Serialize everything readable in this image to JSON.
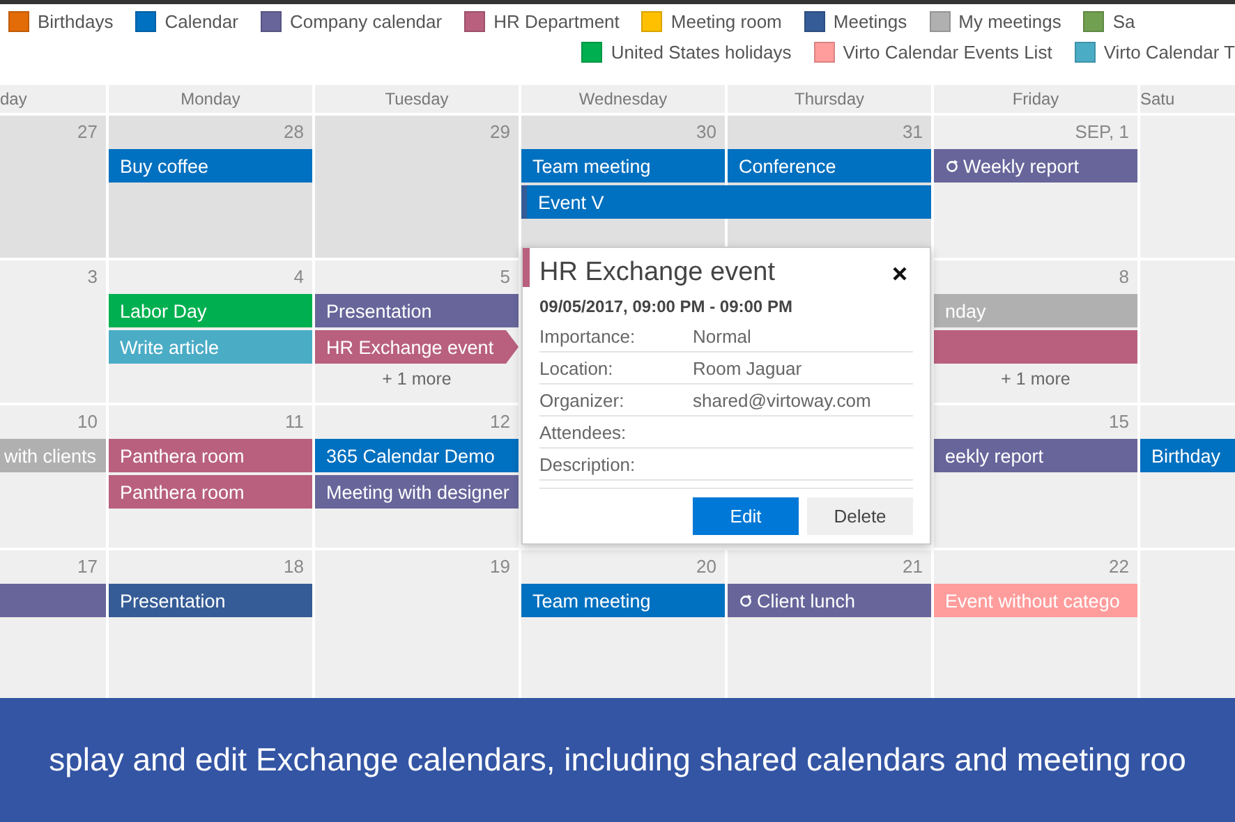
{
  "legend": [
    [
      {
        "label": "Birthdays",
        "color": "#e36c09"
      },
      {
        "label": "Calendar",
        "color": "#0070c0"
      },
      {
        "label": "Company calendar",
        "color": "#67659a"
      },
      {
        "label": "HR Department",
        "color": "#b9607e"
      },
      {
        "label": "Meeting room",
        "color": "#ffc000"
      },
      {
        "label": "Meetings",
        "color": "#355c96"
      },
      {
        "label": "My meetings",
        "color": "#b0b0b0"
      },
      {
        "label": "Sa",
        "color": "#70a050"
      }
    ],
    [
      {
        "label": "United States holidays",
        "color": "#00b050"
      },
      {
        "label": "Virto Calendar Events List",
        "color": "#ff9c9c"
      },
      {
        "label": "Virto Calendar T",
        "color": "#4bacc6"
      }
    ]
  ],
  "weekdays": [
    "day",
    "Monday",
    "Tuesday",
    "Wednesday",
    "Thursday",
    "Friday",
    "Satu"
  ],
  "weeks": [
    {
      "days": [
        {
          "past": true,
          "date": "27"
        },
        {
          "past": true,
          "date": "28",
          "events": [
            {
              "title": "Buy coffee",
              "color": "#0070c0",
              "recurring": false,
              "continues": false,
              "selected": false
            }
          ]
        },
        {
          "past": true,
          "date": "29"
        },
        {
          "past": true,
          "date": "30",
          "events": [
            {
              "title": "Team meeting",
              "color": "#0070c0",
              "recurring": false,
              "continues": false,
              "selected": false
            },
            {
              "title": "Event V",
              "color": "#0070c0",
              "recurring": false,
              "continues": true,
              "selected": false
            }
          ]
        },
        {
          "past": true,
          "date": "31",
          "events": [
            {
              "title": "Conference",
              "color": "#0070c0",
              "recurring": false,
              "continues": false,
              "selected": false
            }
          ]
        },
        {
          "past": false,
          "date": "SEP, 1",
          "events": [
            {
              "title": "Weekly report",
              "color": "#67659a",
              "recurring": true,
              "continues": false,
              "selected": false
            }
          ]
        },
        {
          "past": false
        }
      ]
    },
    {
      "days": [
        {
          "past": false,
          "date": "3"
        },
        {
          "past": false,
          "date": "4",
          "events": [
            {
              "title": "Labor Day",
              "color": "#00b050",
              "recurring": false,
              "continues": false,
              "selected": false
            },
            {
              "title": "Write article",
              "color": "#4bacc6",
              "recurring": false,
              "continues": false,
              "selected": false
            }
          ]
        },
        {
          "past": false,
          "date": "5",
          "events": [
            {
              "title": "Presentation",
              "color": "#67659a",
              "recurring": false,
              "continues": false,
              "selected": false
            },
            {
              "title": "HR Exchange event",
              "color": "#b9607e",
              "recurring": false,
              "continues": false,
              "selected": true
            }
          ],
          "more": "+ 1 more"
        },
        {
          "past": false,
          "date": "8",
          "events": [
            {
              "title": "nday",
              "color": "#b0b0b0",
              "recurring": false,
              "continues": false,
              "selected": false
            },
            {
              "color": "#b9607e",
              "recurring": false,
              "continues": false,
              "selected": false
            }
          ],
          "more": "+ 1 more"
        },
        {
          "past": false
        }
      ]
    },
    {
      "days": [
        {
          "past": false,
          "date": "10",
          "events": [
            {
              "title": "with clients",
              "color": "#b0b0b0",
              "recurring": false,
              "continues": false,
              "selected": false
            }
          ]
        },
        {
          "past": false,
          "date": "11",
          "events": [
            {
              "title": "Panthera room",
              "color": "#b9607e",
              "recurring": false,
              "continues": false,
              "selected": false
            },
            {
              "title": "Panthera room",
              "color": "#b9607e",
              "recurring": false,
              "continues": false,
              "selected": false
            }
          ]
        },
        {
          "past": false,
          "date": "12",
          "events": [
            {
              "title": "365 Calendar Demo",
              "color": "#0070c0",
              "recurring": false,
              "continues": false,
              "selected": false
            },
            {
              "title": "Meeting with designer",
              "color": "#67659a",
              "recurring": false,
              "continues": false,
              "selected": false
            }
          ]
        },
        {
          "past": false,
          "date": "15",
          "events": [
            {
              "title": "eekly report",
              "color": "#67659a",
              "recurring": false,
              "continues": false,
              "selected": false
            }
          ]
        },
        {
          "past": false,
          "events": [
            {
              "title": "Birthday",
              "color": "#0070c0",
              "recurring": false,
              "continues": false,
              "selected": false
            }
          ]
        }
      ]
    },
    {
      "days": [
        {
          "past": false,
          "date": "17",
          "events": [
            {
              "color": "#67659a",
              "recurring": false,
              "continues": false,
              "selected": false
            }
          ]
        },
        {
          "past": false,
          "date": "18",
          "events": [
            {
              "title": "Presentation",
              "color": "#355c96",
              "recurring": false,
              "continues": false,
              "selected": false
            }
          ]
        },
        {
          "past": false,
          "date": "19"
        },
        {
          "past": false,
          "date": "20",
          "events": [
            {
              "title": "Team meeting",
              "color": "#0070c0",
              "recurring": false,
              "continues": false,
              "selected": false
            }
          ]
        },
        {
          "past": false,
          "date": "21",
          "events": [
            {
              "title": "Client lunch",
              "color": "#67659a",
              "recurring": true,
              "continues": false,
              "selected": false
            }
          ]
        },
        {
          "past": false,
          "date": "22",
          "events": [
            {
              "title": "Event without catego",
              "color": "#ff9c9c",
              "recurring": false,
              "continues": false,
              "selected": false
            }
          ]
        },
        {
          "past": false
        }
      ]
    }
  ],
  "popup": {
    "title": "HR Exchange event",
    "color": "#b9607e",
    "when": "09/05/2017, 09:00 PM - 09:00 PM",
    "fields": [
      {
        "label": "Importance:",
        "value": "Normal"
      },
      {
        "label": "Location:",
        "value": "Room Jaguar"
      },
      {
        "label": "Organizer:",
        "value": "shared@virtoway.com"
      },
      {
        "label": "Attendees:"
      },
      {
        "label": "Description:"
      }
    ],
    "buttons": [
      {
        "label": "Edit",
        "kind": "primary"
      },
      {
        "label": "Delete",
        "kind": "secondary"
      }
    ]
  },
  "banner": "splay and edit Exchange calendars, including shared calendars and meeting roo"
}
